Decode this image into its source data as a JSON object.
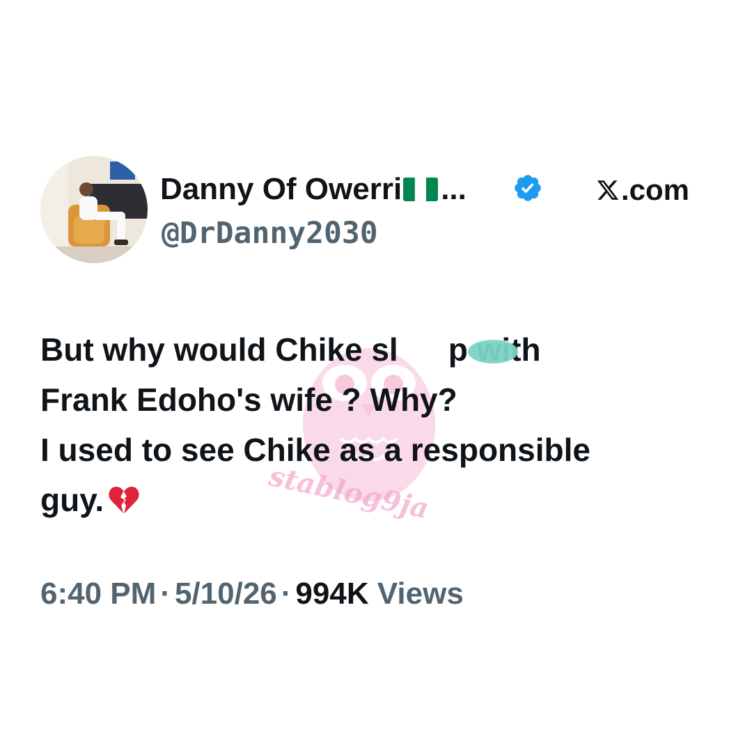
{
  "author": {
    "display_name": "Danny Of Owerri",
    "ellipsis": "...",
    "handle": "@DrDanny2030",
    "verified": true,
    "avatar": "profile-photo"
  },
  "source": {
    "label": ".com",
    "logo": "x-logo-icon"
  },
  "tweet": {
    "lines": [
      "But why would Chike sl",
      "p with",
      "Frank Edoho's wife ? Why?",
      "I used to see Chike as a responsible",
      "guy."
    ],
    "emoji": "broken-heart-icon"
  },
  "meta": {
    "time": "6:40 PM",
    "separator": "·",
    "date": "5/10/26",
    "views_count": "994K",
    "views_label": "Views"
  },
  "watermark": {
    "text": "stablog9ja"
  },
  "colors": {
    "text_primary": "#0f1419",
    "text_secondary": "#536471",
    "verified_blue": "#1d9bf0",
    "nigeria_green": "#008751",
    "watermark_pink": "#f4a6c8",
    "blur_teal": "#7bd3c6"
  }
}
